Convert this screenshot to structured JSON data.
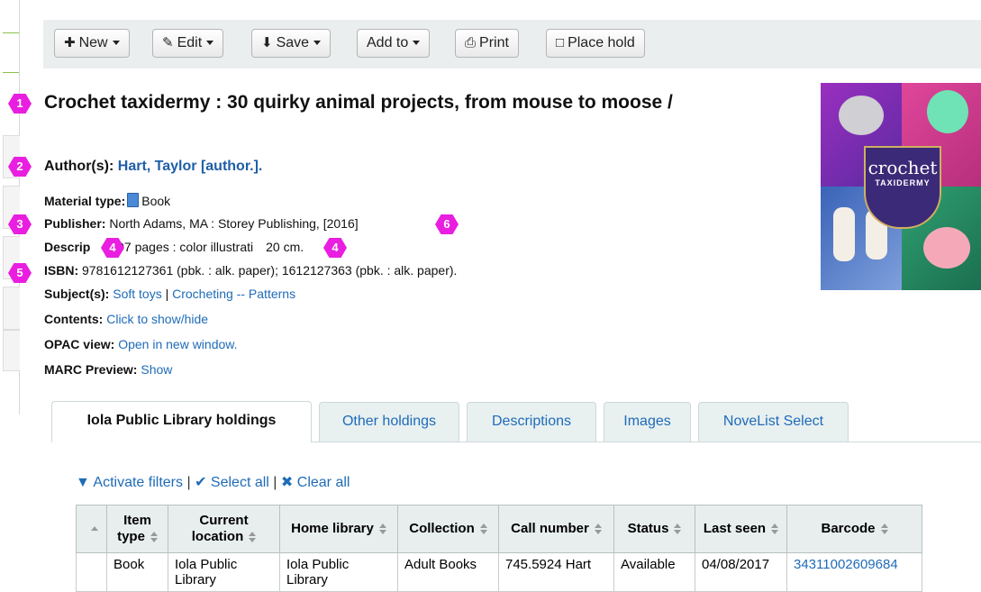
{
  "toolbar": {
    "new": "New",
    "edit": "Edit",
    "save": "Save",
    "add_to": "Add to",
    "print": "Print",
    "place_hold": "Place hold"
  },
  "markers": [
    "1",
    "2",
    "3",
    "4",
    "4",
    "5",
    "6"
  ],
  "record": {
    "title": "Crochet taxidermy : 30 quirky animal projects, from mouse to moose /",
    "author_label": "Author(s):",
    "author": "Hart, Taylor [author.].",
    "material_label": "Material type:",
    "material": "Book",
    "publisher_label": "Publisher:",
    "publisher": "North Adams, MA : Storey Publishing, [2016]",
    "description_label": "Descrip",
    "description_a": "207 pages : color illustrati",
    "description_b": "20 cm.",
    "isbn_label": "ISBN:",
    "isbn": "9781612127361 (pbk. : alk. paper); 1612127363 (pbk. : alk. paper).",
    "subjects_label": "Subject(s):",
    "subject_1": "Soft toys",
    "subject_sep": "|",
    "subject_2": "Crocheting -- Patterns",
    "contents_label": "Contents:",
    "contents": "Click to show/hide",
    "opac_label": "OPAC view:",
    "opac": "Open in new window.",
    "marc_label": "MARC Preview:",
    "marc": "Show"
  },
  "cover": {
    "title": "crochet",
    "subtitle": "TAXIDERMY"
  },
  "tabs": [
    "Iola Public Library holdings",
    "Other holdings",
    "Descriptions",
    "Images",
    "NoveList Select"
  ],
  "filters": {
    "activate": "Activate filters",
    "select_all": "Select all",
    "clear_all": "Clear all",
    "sep": "|"
  },
  "table": {
    "headers": [
      "Item type",
      "Current location",
      "Home library",
      "Collection",
      "Call number",
      "Status",
      "Last seen",
      "Barcode"
    ],
    "row": [
      "Book",
      "Iola Public Library",
      "Iola Public Library",
      "Adult Books",
      "745.5924 Hart",
      "Available",
      "04/08/2017",
      "34311002609684"
    ]
  },
  "colors": {
    "link": "#1f6bb8",
    "marker": "#e91ee0",
    "toolbar_bg": "#eaeeee"
  }
}
